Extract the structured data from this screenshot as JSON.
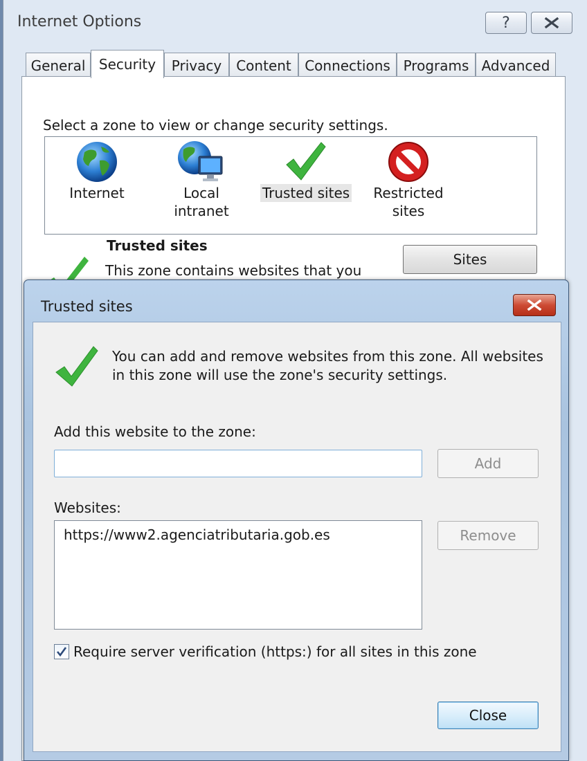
{
  "outer_window": {
    "title": "Internet Options",
    "help_glyph": "?",
    "tabs": [
      {
        "label": "General"
      },
      {
        "label": "Security",
        "active": true
      },
      {
        "label": "Privacy"
      },
      {
        "label": "Content"
      },
      {
        "label": "Connections"
      },
      {
        "label": "Programs"
      },
      {
        "label": "Advanced"
      }
    ],
    "security": {
      "zone_instruction": "Select a zone to view or change security settings.",
      "zones": [
        {
          "label": "Internet",
          "icon": "globe-icon"
        },
        {
          "label": "Local intranet",
          "icon": "intranet-icon"
        },
        {
          "label": "Trusted sites",
          "icon": "checkmark-icon",
          "selected": true
        },
        {
          "label": "Restricted",
          "label2": "sites",
          "icon": "restricted-icon"
        }
      ],
      "zone_heading": "Trusted sites",
      "zone_description": "This zone contains websites that you",
      "sites_button": "Sites"
    }
  },
  "dialog": {
    "title": "Trusted sites",
    "info_text": "You can add and remove websites from this zone. All websites in this zone will use the zone's security settings.",
    "add_label": "Add this website to the zone:",
    "add_input_value": "",
    "add_button": "Add",
    "websites_label": "Websites:",
    "websites": [
      "https://www2.agenciatributaria.gob.es"
    ],
    "remove_button": "Remove",
    "require_https_label": "Require server verification (https:) for all sites in this zone",
    "require_https_checked": true,
    "close_button": "Close"
  },
  "colors": {
    "check_green": "#3fb43f",
    "dialog_close_red": "#c7432c",
    "dialog_frame": "#a9c3df"
  }
}
